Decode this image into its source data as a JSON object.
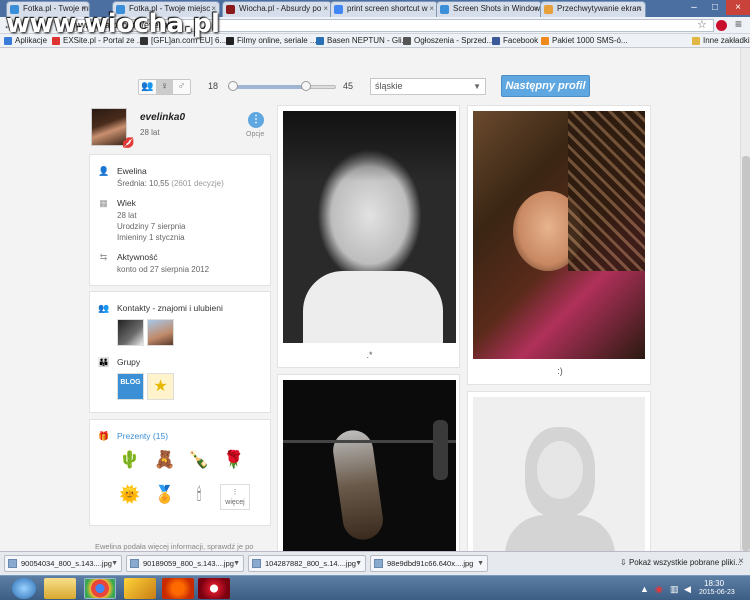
{
  "browser": {
    "tabs": [
      {
        "label": "Fotka.pl - Twoje miejsce",
        "color": "#3b8fd9"
      },
      {
        "label": "Fotka.pl - Twoje miejsc",
        "color": "#3b8fd9"
      },
      {
        "label": "Wiocha.pl - Absurdy po",
        "color": "#8b1a1a"
      },
      {
        "label": "print screen shortcut w",
        "color": "#4285f4"
      },
      {
        "label": "Screen Shots in Window",
        "color": "#3b8fd9"
      },
      {
        "label": "Przechwytywanie ekran",
        "color": "#e8a03a"
      }
    ],
    "url": "www.fotka.pl/profil/evelinka0",
    "bookmarks": [
      {
        "label": "Aplikacje",
        "color": "#3b7bd9"
      },
      {
        "label": "EXSite.pl - Portal ze ...",
        "color": "#d33"
      },
      {
        "label": "[GFL]an.com EU] 6...",
        "color": "#333"
      },
      {
        "label": "Filmy online, seriale ...",
        "color": "#222"
      },
      {
        "label": "Basen NEPTUN - Gli...",
        "color": "#2a6fb4"
      },
      {
        "label": "Ogłoszenia - Sprzed...",
        "color": "#555"
      },
      {
        "label": "Facebook",
        "color": "#3b5998"
      },
      {
        "label": "Pakiet 1000 SMS-ó...",
        "color": "#f08a1c"
      },
      {
        "label": "Inne zakładki",
        "color": "#e0b740"
      }
    ],
    "watermark": "www.wiocha.pl"
  },
  "filters": {
    "age_min": "18",
    "age_max": "45",
    "age_range_fraction": [
      0.05,
      0.72
    ],
    "region": "śląskie",
    "next_button": "Następny profil"
  },
  "profile": {
    "username": "evelinka0",
    "age": "28 lat",
    "options_label": "Opcje",
    "name": "Ewelina",
    "rating_label": "Średnia: 10,55",
    "rating_votes": "(2601 decyzje)",
    "age_section_title": "Wiek",
    "age_value": "28 lat",
    "birthday": "Urodziny 7 sierpnia",
    "nameday": "Imieniny 1 stycznia",
    "activity_title": "Aktywność",
    "account_since": "konto od 27 sierpnia 2012",
    "contacts_title": "Kontakty - znajomi i ulubieni",
    "groups_title": "Grupy",
    "group_blog_label": "BLOG",
    "gifts_title": "Prezenty (15)",
    "more_label": "więcej",
    "info_text": "Ewelina podała więcej informacji, sprawdź je po"
  },
  "photos": {
    "captions": [
      ".*",
      ":)"
    ]
  },
  "downloads": {
    "items": [
      "90054034_800_s.143....jpg",
      "90189059_800_s.143....jpg",
      "104287882_800_s.14....jpg",
      "98e9dbd91c66.640x....jpg"
    ],
    "show_all": "Pokaż wszystkie pobrane pliki..."
  },
  "taskbar": {
    "time": "18:30",
    "date": "2015-06-23"
  }
}
